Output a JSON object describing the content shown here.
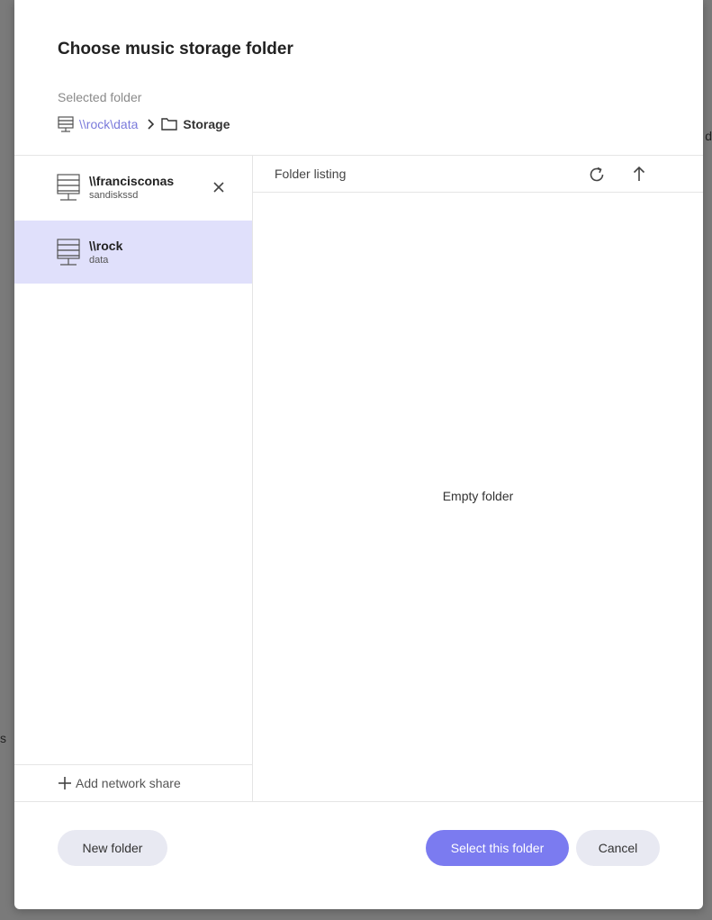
{
  "backdrop": {
    "hint_right": "d",
    "hint_left": "s"
  },
  "dialog": {
    "title": "Choose music storage folder",
    "selected_label": "Selected folder",
    "breadcrumb": {
      "path_link": "\\\\rock\\data",
      "current": "Storage"
    }
  },
  "shares": [
    {
      "name": "\\\\francisconas",
      "sub": "sandiskssd",
      "icon": "server-icon",
      "closable": true
    },
    {
      "name": "\\\\rock",
      "sub": "data",
      "icon": "server-icon",
      "selected": true
    }
  ],
  "add_share_label": "Add network share",
  "listing": {
    "title": "Folder listing",
    "empty_text": "Empty folder"
  },
  "footer": {
    "new_folder": "New folder",
    "select_folder": "Select this folder",
    "cancel": "Cancel"
  },
  "colors": {
    "accent": "#7b7bf0",
    "selected_bg": "#e0e0fb",
    "link": "#7a7adb"
  }
}
